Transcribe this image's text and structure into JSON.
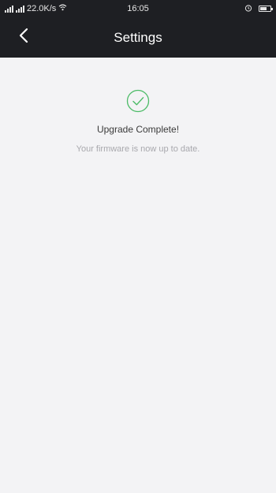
{
  "status_bar": {
    "left_text": "22.0K/s",
    "time": "16:05"
  },
  "header": {
    "title": "Settings",
    "back_icon": "chevron-left-icon"
  },
  "main": {
    "status_icon": "check-circle-icon",
    "accent_color": "#4cbb67",
    "headline": "Upgrade Complete!",
    "message": "Your firmware is now up to date."
  }
}
